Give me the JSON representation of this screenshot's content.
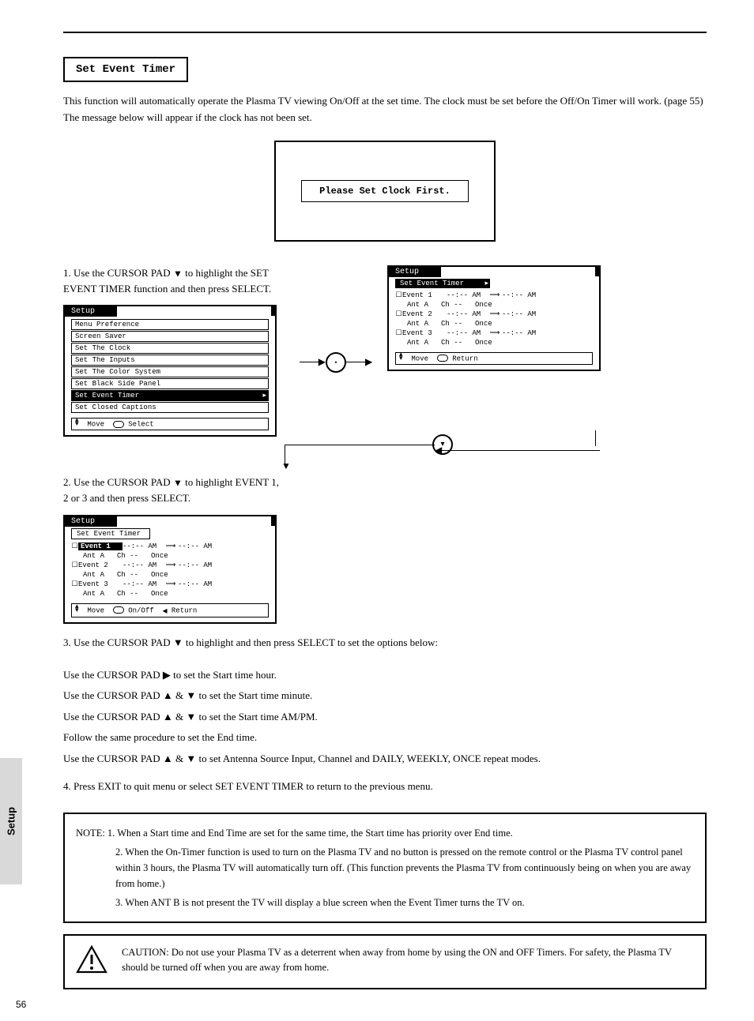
{
  "side_tab": "Setup",
  "heading_box": "Set Event Timer",
  "intro": "This function will automatically operate the Plasma TV viewing On/Off at the set time. The clock must be set before the Off/On Timer will work. (page 55) The message below will appear if the clock has not been set.",
  "clock_msg": "Please Set Clock First.",
  "step1": {
    "label": "1.",
    "text_a": "Use the CURSOR PAD",
    "tri_down": "▼",
    "text_b": " to highlight the SET EVENT TIMER function and then press SELECT.",
    "osd": {
      "title": "Setup",
      "items": [
        {
          "label": "Menu Preference",
          "sel": false
        },
        {
          "label": "Screen Saver",
          "sel": false
        },
        {
          "label": "Set The Clock",
          "sel": false
        },
        {
          "label": "Set The Inputs",
          "sel": false
        },
        {
          "label": "Set The Color System",
          "sel": false
        },
        {
          "label": "Set Black Side Panel",
          "sel": false
        },
        {
          "label": "Set Event Timer",
          "sel": true
        },
        {
          "label": "Set Closed Captions",
          "sel": false
        }
      ],
      "footer_move": "Move",
      "footer_select": "Select"
    }
  },
  "osd_events": {
    "title": "Setup",
    "subtitle": "Set Event Timer",
    "events": [
      {
        "n": 1,
        "start": "--:-- AM",
        "end": "--:-- AM",
        "ant": "Ant A",
        "ch": "Ch --",
        "mode": "Once",
        "sel": false
      },
      {
        "n": 2,
        "start": "--:-- AM",
        "end": "--:-- AM",
        "ant": "Ant A",
        "ch": "Ch --",
        "mode": "Once",
        "sel": false
      },
      {
        "n": 3,
        "start": "--:-- AM",
        "end": "--:-- AM",
        "ant": "Ant A",
        "ch": "Ch --",
        "mode": "Once",
        "sel": false
      }
    ],
    "footer_move": "Move",
    "footer_return": "Return"
  },
  "step2": {
    "label": "2.",
    "text_a": "Use the CURSOR PAD",
    "tri_down": "▼",
    "text_b": " to highlight EVENT 1, 2 or 3 and then press SELECT."
  },
  "osd_events_sel": {
    "title": "Setup",
    "subtitle": "Set Event Timer",
    "selected_event": 1,
    "events": [
      {
        "n": 1,
        "start": "--:-- AM",
        "end": "--:-- AM",
        "ant": "Ant A",
        "ch": "Ch --",
        "mode": "Once",
        "sel": true
      },
      {
        "n": 2,
        "start": "--:-- AM",
        "end": "--:-- AM",
        "ant": "Ant A",
        "ch": "Ch --",
        "mode": "Once",
        "sel": false
      },
      {
        "n": 3,
        "start": "--:-- AM",
        "end": "--:-- AM",
        "ant": "Ant A",
        "ch": "Ch --",
        "mode": "Once",
        "sel": false
      }
    ],
    "footer_move": "Move",
    "footer_onoff": "On/Off",
    "footer_return": "Return",
    "footer_return_glyph": "◂"
  },
  "step3_leadin": "3. Use the CURSOR PAD ▼ to highlight and then press SELECT to set the options below:",
  "step3_items": [
    "Use the CURSOR PAD ▶ to set the Start time hour.",
    "Use the CURSOR PAD ▲ & ▼ to set the Start time minute.",
    "Use the CURSOR PAD ▲ & ▼ to set the Start time AM/PM.",
    "Follow the same procedure to set the End time.",
    "Use the CURSOR PAD ▲ & ▼ to set Antenna Source Input, Channel and DAILY, WEEKLY, ONCE repeat modes."
  ],
  "step4": "4. Press EXIT to quit menu or select SET EVENT TIMER to return to the previous menu.",
  "notes": [
    "NOTE: 1. When a Start time and End Time are set for the same time, the Start time has priority over End time.",
    "2. When the On-Timer function is used to turn on the Plasma TV and no button is pressed on the remote control or the Plasma TV control panel within 3 hours, the Plasma TV will automatically turn off. (This function prevents the Plasma TV from continuously being on when you are away from home.)",
    "3. When ANT B is not present the TV will display a blue screen when the Event Timer turns the TV on."
  ],
  "caution": "CAUTION: Do not use your Plasma TV as a deterrent when away from home by using the ON and OFF Timers. For safety, the Plasma TV should be turned off when you are away from home.",
  "page_number": "56"
}
